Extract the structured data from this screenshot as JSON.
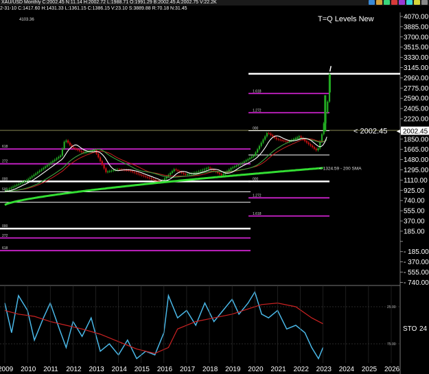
{
  "header": {
    "title": "XAU/USD  Monthly  C:2002.45  N:11.14  H:2002.72  L:1988.71  O:1991.29  B:2002.45  A:2002.75  V:22.2K",
    "info": "2-31-10  C:1417.60  H:1431.33  L:1361.15  C:1386.15  V:23.10  S:3889.88  R:70.18  N:31.45"
  },
  "colors": {
    "background": "#000000",
    "price_line": "#ffffff",
    "fast_ma": "#ffffff",
    "mid_ma": "#3c9a3c",
    "sma200": "#33dd33",
    "slow_ma_red": "#cc2222",
    "fib_level": "#cc22cc",
    "stoch_k": "#4ab8e8",
    "stoch_d": "#cc2222",
    "up_candle": "#22aa22",
    "down_candle": "#cc1111"
  },
  "chart_data": [
    {
      "type": "candlestick",
      "title": "T=Q Levels New",
      "top_left_label": "4103.36",
      "y_ticks": [
        "4070.00",
        "3885.00",
        "3700.00",
        "3515.00",
        "3330.00",
        "3145.00",
        "2960.00",
        "2775.00",
        "2590.00",
        "2405.00",
        "2220.00",
        "2035.00",
        "1850.00",
        "1665.00",
        "1480.00",
        "1295.00",
        "1110.00",
        "925.00",
        "740.00",
        "555.00",
        "370.00",
        "185.00",
        "",
        "- 185.00",
        "- 370.00",
        "- 555.00",
        "- 740.00"
      ],
      "x_ticks": [
        "2009",
        "2010",
        "2011",
        "2012",
        "2013",
        "2014",
        "2015",
        "2016",
        "2017",
        "2018",
        "2019",
        "2020",
        "2021",
        "2022",
        "2023",
        "2024",
        "2025",
        "2026"
      ],
      "ylim": [
        -740,
        4070
      ],
      "current_price": {
        "value": 2002.45,
        "label": "< 2002.45",
        "axis_label": "2002.45"
      },
      "sma_label": "<  1324.59 - 200 SMA",
      "series": [
        {
          "name": "XAU/USD",
          "x": [
            "2009.0",
            "2009.5",
            "2010.0",
            "2010.5",
            "2011.0",
            "2011.5",
            "2011.7",
            "2012.0",
            "2012.5",
            "2013.0",
            "2013.5",
            "2014.0",
            "2014.5",
            "2015.0",
            "2015.9",
            "2016.5",
            "2017.0",
            "2017.5",
            "2018.0",
            "2018.6",
            "2019.0",
            "2019.5",
            "2020.0",
            "2020.6",
            "2021.0",
            "2021.5",
            "2022.0",
            "2022.8",
            "2023.0",
            "2023.3",
            "2023.4"
          ],
          "values": [
            900,
            1000,
            1100,
            1250,
            1400,
            1550,
            1850,
            1700,
            1600,
            1650,
            1250,
            1300,
            1280,
            1200,
            1060,
            1300,
            1200,
            1250,
            1330,
            1190,
            1320,
            1420,
            1550,
            1970,
            1850,
            1800,
            1900,
            1630,
            1940,
            2650,
            3030
          ]
        }
      ],
      "indicators": [
        {
          "name": "200 SMA",
          "latest": 1324.59
        }
      ],
      "horizontal_levels": [
        {
          "value": 3040,
          "color": "white",
          "label": ""
        },
        {
          "value": 2680,
          "color": "magenta",
          "label": "1.618"
        },
        {
          "value": 2330,
          "color": "magenta",
          "label": "1.272"
        },
        {
          "value": 2002.45,
          "color": "white",
          "label": "000"
        },
        {
          "value": 1560,
          "color": "white",
          "label": ""
        },
        {
          "value": 1080,
          "color": "white",
          "label": "000"
        },
        {
          "value": 780,
          "color": "magenta",
          "label": "1.272"
        },
        {
          "value": 450,
          "color": "magenta",
          "label": "1.618"
        },
        {
          "value": 1670,
          "color": "magenta",
          "label": "618"
        },
        {
          "value": 1400,
          "color": "magenta",
          "label": "272"
        },
        {
          "value": 1080,
          "color": "white",
          "label": "000"
        },
        {
          "value": 890,
          "color": "white",
          "label": "500"
        },
        {
          "value": 700,
          "color": "white",
          "label": ""
        },
        {
          "value": 220,
          "color": "white",
          "label": "000"
        },
        {
          "value": 50,
          "color": "magenta",
          "label": "272"
        },
        {
          "value": -180,
          "color": "magenta",
          "label": "618"
        }
      ]
    },
    {
      "type": "line",
      "title": "",
      "label": "STO",
      "label_value": "24",
      "ylim": [
        0,
        100
      ],
      "y_ticks": [
        "25.00",
        "75.00"
      ],
      "series": [
        {
          "name": "",
          "x": [
            "2009.0",
            "2009.3",
            "2009.6",
            "2010.0",
            "2010.3",
            "2010.7",
            "2011.0",
            "2011.4",
            "2011.7",
            "2012.0",
            "2012.4",
            "2012.8",
            "2013.2",
            "2013.6",
            "2014.0",
            "2014.4",
            "2014.8",
            "2015.2",
            "2015.6",
            "2016.0",
            "2016.2",
            "2016.6",
            "2017.0",
            "2017.4",
            "2017.8",
            "2018.2",
            "2018.6",
            "2019.0",
            "2019.3",
            "2019.7",
            "2020.0",
            "2020.3",
            "2020.6",
            "2021.0",
            "2021.4",
            "2021.8",
            "2022.2",
            "2022.5",
            "2022.8",
            "2023.0"
          ],
          "values": [
            20,
            60,
            10,
            30,
            70,
            40,
            20,
            55,
            80,
            45,
            65,
            40,
            85,
            75,
            90,
            70,
            95,
            85,
            90,
            60,
            10,
            40,
            30,
            50,
            20,
            45,
            30,
            15,
            35,
            20,
            5,
            35,
            40,
            30,
            55,
            50,
            60,
            80,
            95,
            80
          ]
        },
        {
          "name": "",
          "x": [
            "2009.0",
            "2009.6",
            "2010.3",
            "2011.0",
            "2011.7",
            "2012.4",
            "2013.2",
            "2014.0",
            "2014.8",
            "2015.6",
            "2016.2",
            "2016.6",
            "2017.4",
            "2018.2",
            "2019.0",
            "2019.7",
            "2020.3",
            "2021.0",
            "2021.8",
            "2022.5",
            "2023.0"
          ],
          "values": [
            30,
            35,
            38,
            45,
            50,
            55,
            62,
            72,
            82,
            88,
            80,
            55,
            45,
            40,
            35,
            28,
            22,
            20,
            25,
            40,
            48
          ]
        }
      ]
    }
  ]
}
